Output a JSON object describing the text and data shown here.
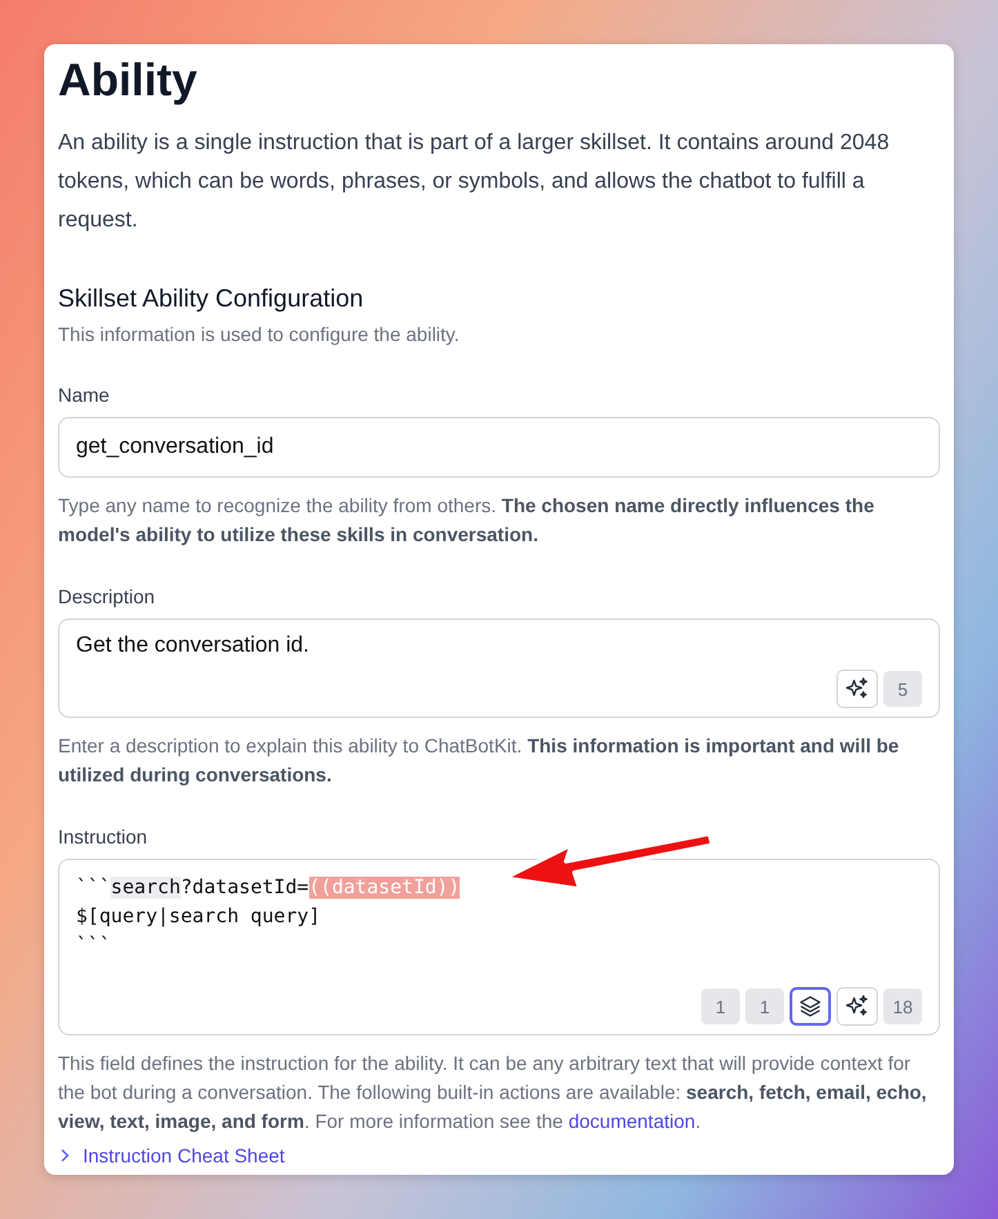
{
  "title": "Ability",
  "intro": "An ability is a single instruction that is part of a larger skillset. It contains around 2048 tokens, which can be words, phrases, or symbols, and allows the chatbot to fulfill a request.",
  "section": {
    "heading": "Skillset Ability Configuration",
    "subheading": "This information is used to configure the ability."
  },
  "name_field": {
    "label": "Name",
    "value": "get_conversation_id",
    "help": "Type any name to recognize the ability from others. **The chosen name directly influences the model's ability to utilize these skills in conversation.**"
  },
  "description_field": {
    "label": "Description",
    "value": "Get the conversation id.",
    "token_count": "5",
    "help": "Enter a description to explain this ability to ChatBotKit. **This information is important and will be utilized during conversations.**"
  },
  "instruction_field": {
    "label": "Instruction",
    "lines": [
      [
        {
          "kind": "plain",
          "text": "```"
        },
        {
          "kind": "keyword",
          "text": "search"
        },
        {
          "kind": "plain",
          "text": "?datasetId="
        },
        {
          "kind": "variable",
          "text": "((datasetId))"
        }
      ],
      [
        {
          "kind": "plain",
          "text": "$[query|search query]"
        }
      ],
      [
        {
          "kind": "plain",
          "text": "```"
        }
      ]
    ],
    "counters": [
      "1",
      "1"
    ],
    "layers_selected": true,
    "token_count": "18",
    "help_before": "This field defines the instruction for the ability. It can be any arbitrary text that will provide context for the bot during a conversation. The following built-in actions are available: **search, fetch, email, echo, view, text, image, and form**. For more information see the ",
    "help_link": "documentation",
    "help_after": "."
  },
  "cheat_sheet": {
    "label": "Instruction Cheat Sheet",
    "expanded": false
  }
}
